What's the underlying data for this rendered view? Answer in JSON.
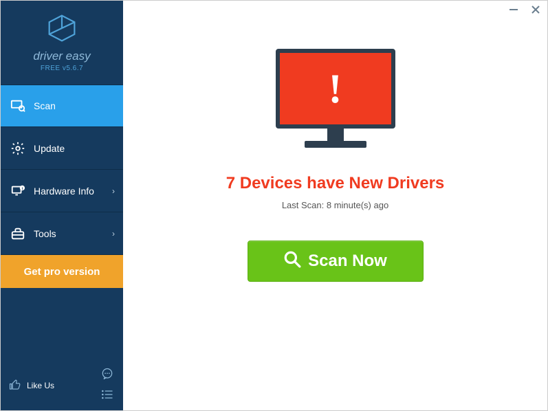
{
  "brand": {
    "name": "driver easy",
    "version": "FREE v5.6.7"
  },
  "nav": {
    "scan": "Scan",
    "update": "Update",
    "hardware": "Hardware Info",
    "tools": "Tools"
  },
  "cta": {
    "get_pro": "Get pro version",
    "like_us": "Like Us",
    "scan_now": "Scan Now"
  },
  "status": {
    "headline": "7 Devices have New Drivers",
    "last_scan": "Last Scan: 8 minute(s) ago"
  }
}
